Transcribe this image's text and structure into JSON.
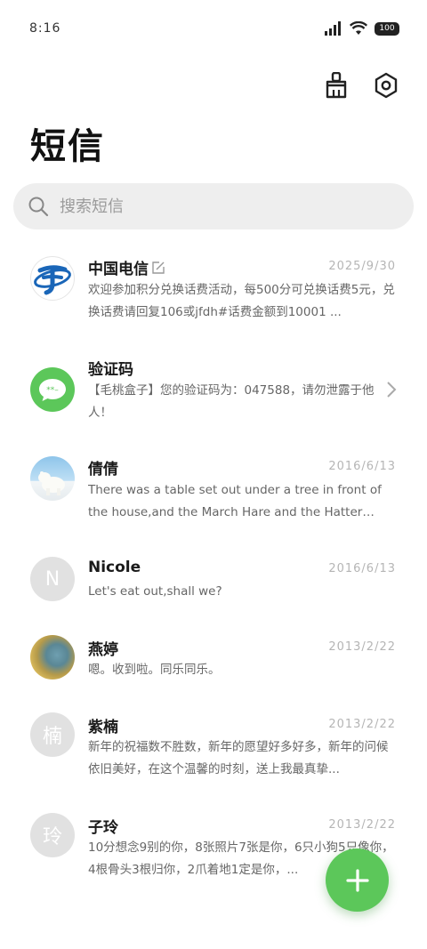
{
  "status": {
    "time": "8:16",
    "battery": "100"
  },
  "page_title": "短信",
  "search": {
    "placeholder": "搜索短信"
  },
  "messages": [
    {
      "sender": "中国电信",
      "date": "2025/9/30",
      "preview": "欢迎参加积分兑换话费活动，每500分可兑换话费5元，兑换话费请回复106或jfdh#话费金额到10001 ..."
    },
    {
      "sender": "验证码",
      "date": "",
      "preview": "【毛桃盒子】您的验证码为：047588，请勿泄露于他人！"
    },
    {
      "sender": "倩倩",
      "date": "2016/6/13",
      "preview": "There was a table set out under a tree in front of the house,and the March Hare and the Hatter were having ..."
    },
    {
      "sender": "Nicole",
      "date": "2016/6/13",
      "avatar_letter": "N",
      "preview": "Let's eat out,shall we?"
    },
    {
      "sender": "燕婷",
      "date": "2013/2/22",
      "preview": "嗯。收到啦。同乐同乐。"
    },
    {
      "sender": "紫楠",
      "date": "2013/2/22",
      "avatar_letter": "楠",
      "preview": "新年的祝福数不胜数，新年的愿望好多好多，新年的问候依旧美好，在这个温馨的时刻，送上我最真挚..."
    },
    {
      "sender": "子玲",
      "date": "2013/2/22",
      "avatar_letter": "玲",
      "preview": "10分想念9别的你，8张照片7张是你，6只小狗5只像你，4根骨头3根归你，2爪着地1定是你，..."
    }
  ],
  "colors": {
    "fab": "#5cc75a",
    "verification_avatar": "#5cc75a",
    "telecom_blue": "#1a66b8"
  }
}
